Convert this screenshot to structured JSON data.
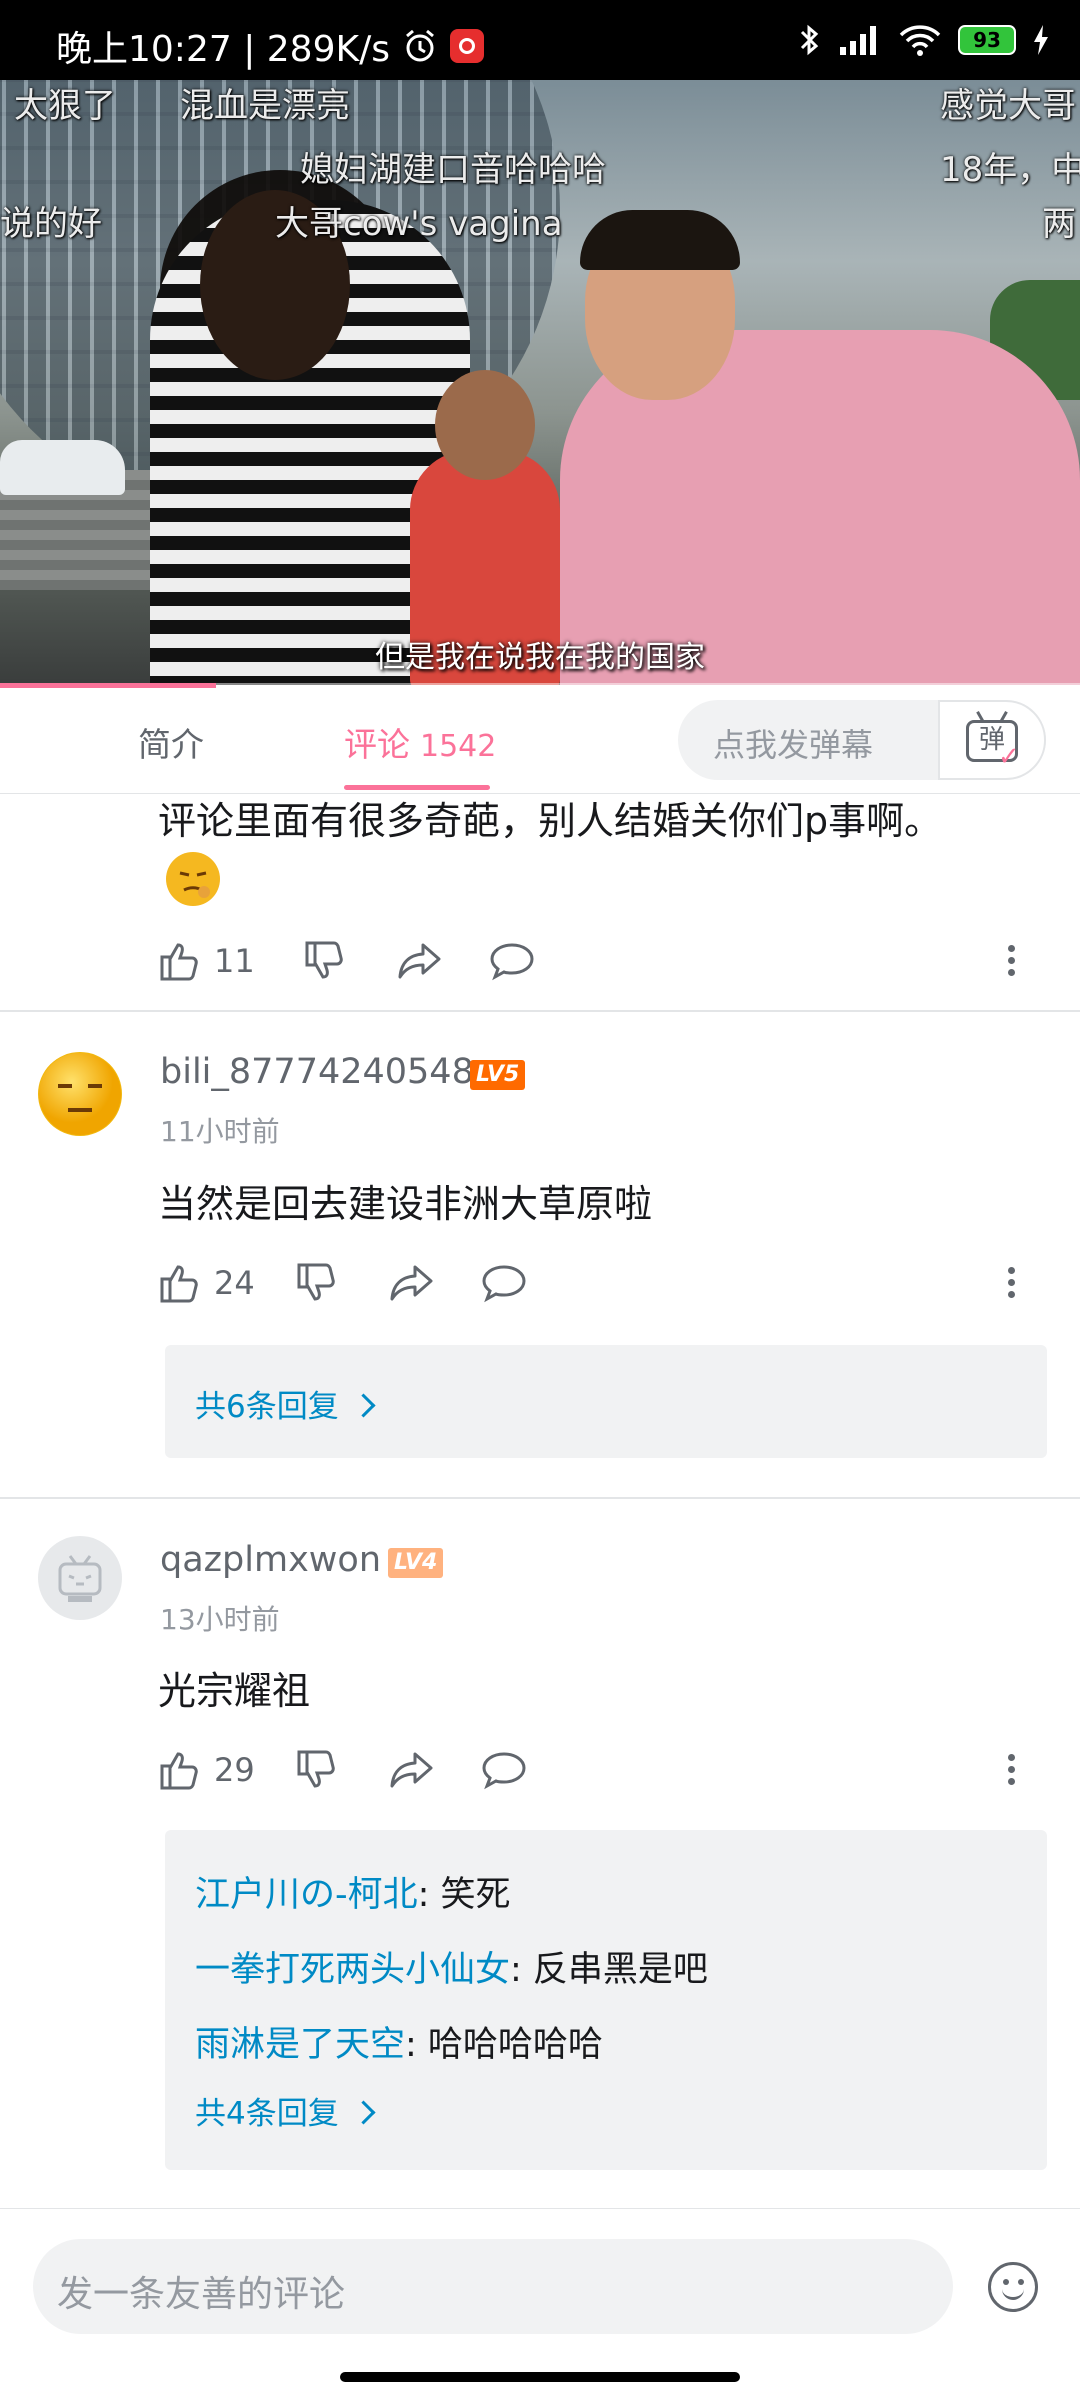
{
  "status_bar": {
    "time": "晚上10:27 | 289K/s",
    "battery": "93",
    "icons": [
      "alarm-icon",
      "netease-music-icon",
      "bluetooth-icon",
      "signal-icon",
      "wifi-icon",
      "battery-icon",
      "charging-icon"
    ]
  },
  "video": {
    "danmaku": [
      "太狠了",
      "混血是漂亮",
      "感觉大哥",
      "媳妇湖建口音哈哈哈",
      "18年，中",
      "说的好",
      "大哥cow's vagina",
      "两"
    ],
    "subtitle": "但是我在说我在我的国家",
    "progress": 0.2
  },
  "tabs": {
    "intro": "简介",
    "comments": "评论",
    "comments_count": "1542",
    "danmaku_placeholder": "点我发弹幕",
    "danmaku_button": "弹"
  },
  "comments": [
    {
      "text": "评论里面有很多奇葩，别人结婚关你们p事啊。",
      "emoji": "smirk-emoji",
      "likes": "11"
    },
    {
      "username": "bili_87774240548",
      "level": "LV5",
      "level_color": "#ff6a00",
      "time": "11小时前",
      "text": "当然是回去建设非洲大草原啦",
      "likes": "24",
      "reply_summary": "共6条回复"
    },
    {
      "username": "qazplmxwon",
      "level": "LV4",
      "level_color": "#ffb27f",
      "time": "13小时前",
      "text": "光宗耀祖",
      "likes": "29",
      "replies": [
        {
          "name": "江户川の-柯北",
          "text": ": 笑死"
        },
        {
          "name": "一拳打死两头小仙女",
          "text": ": 反串黑是吧"
        },
        {
          "name": "雨淋是了天空",
          "text": ": 哈哈哈哈哈"
        }
      ],
      "reply_summary": "共4条回复"
    }
  ],
  "bottom": {
    "placeholder": "发一条友善的评论"
  },
  "colors": {
    "accent": "#fb7299",
    "link": "#008ac5",
    "muted": "#61666d"
  }
}
